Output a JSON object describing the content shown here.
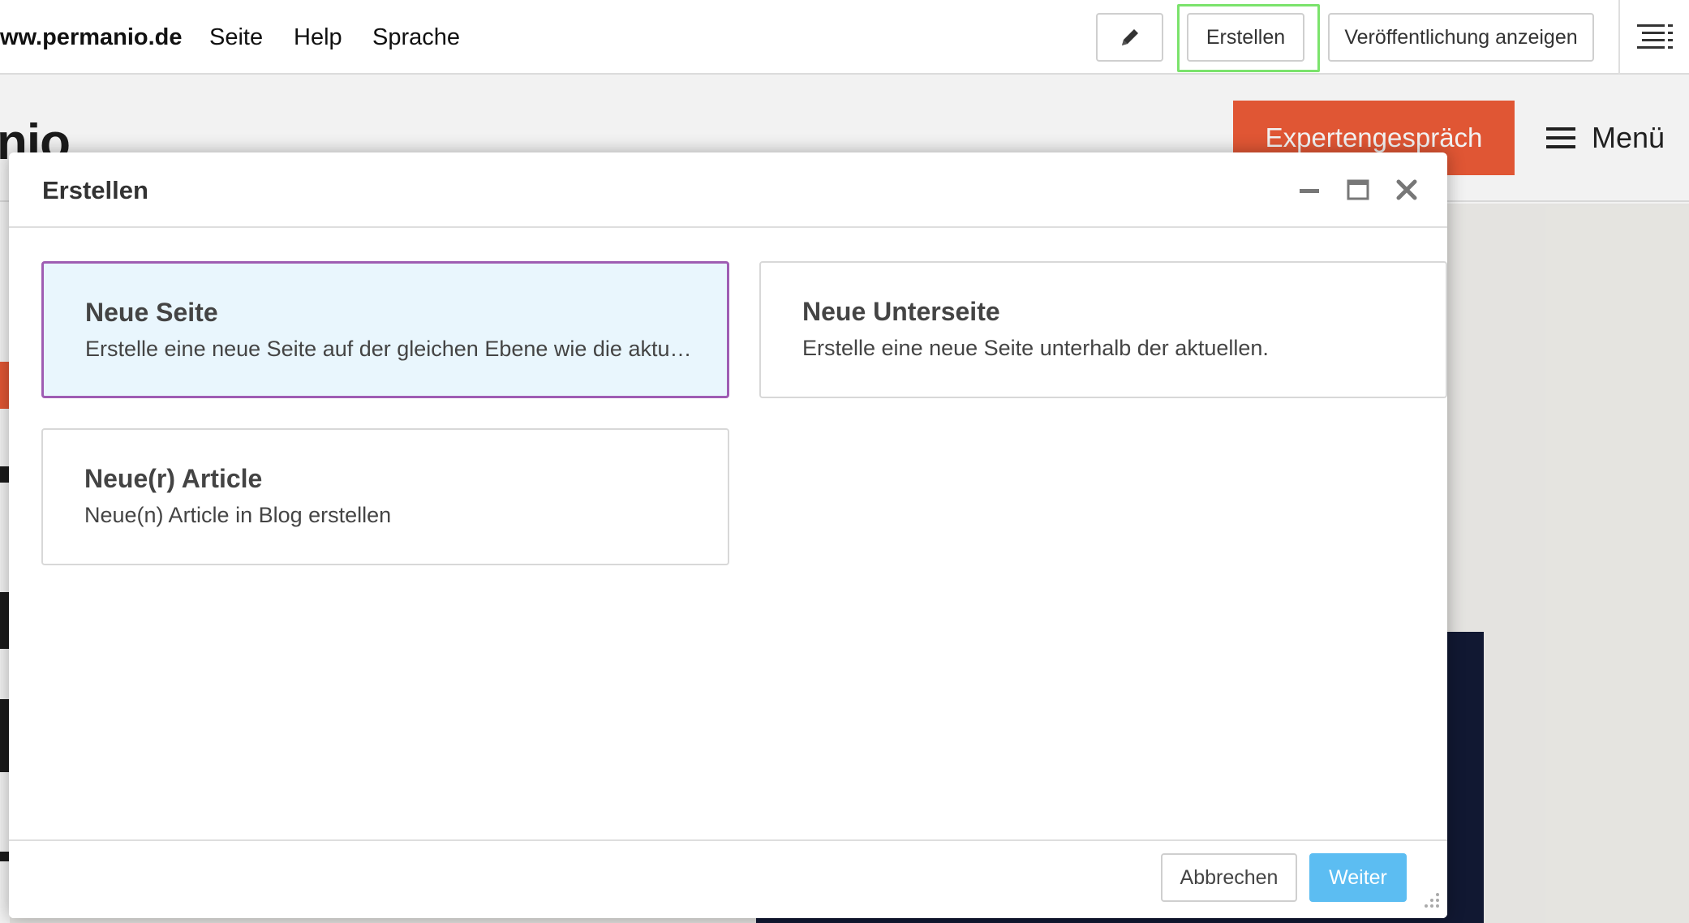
{
  "toolbar": {
    "site_title": "ww.permanio.de",
    "menu": [
      {
        "label": "Seite"
      },
      {
        "label": "Help"
      },
      {
        "label": "Sprache"
      }
    ],
    "edit_icon": "pencil-icon",
    "create_label": "Erstellen",
    "view_published_label": "Veröffentlichung anzeigen",
    "structure_icon": "structure-menu-icon",
    "highlight_color": "#7be36c"
  },
  "website": {
    "logo_text": "nio",
    "cta_label": "Expertengespräch",
    "cta_color": "#ed5b37",
    "menu_label": "Menü",
    "menu_icon": "hamburger-icon"
  },
  "modal": {
    "title": "Erstellen",
    "controls": [
      "minimize-icon",
      "maximize-icon",
      "close-icon"
    ],
    "options": [
      {
        "title": "Neue Seite",
        "description": "Erstelle eine neue Seite auf der gleichen Ebene wie die aktuelle.",
        "selected": true
      },
      {
        "title": "Neue Unterseite",
        "description": "Erstelle eine neue Seite unterhalb der aktuellen.",
        "selected": false
      },
      {
        "title": "Neue(r) Article",
        "description": "Neue(n) Article in Blog erstellen",
        "selected": false
      }
    ],
    "cancel_label": "Abbrechen",
    "next_label": "Weiter",
    "next_color": "#5cbdf2",
    "selected_border_color": "#9f5db3"
  }
}
